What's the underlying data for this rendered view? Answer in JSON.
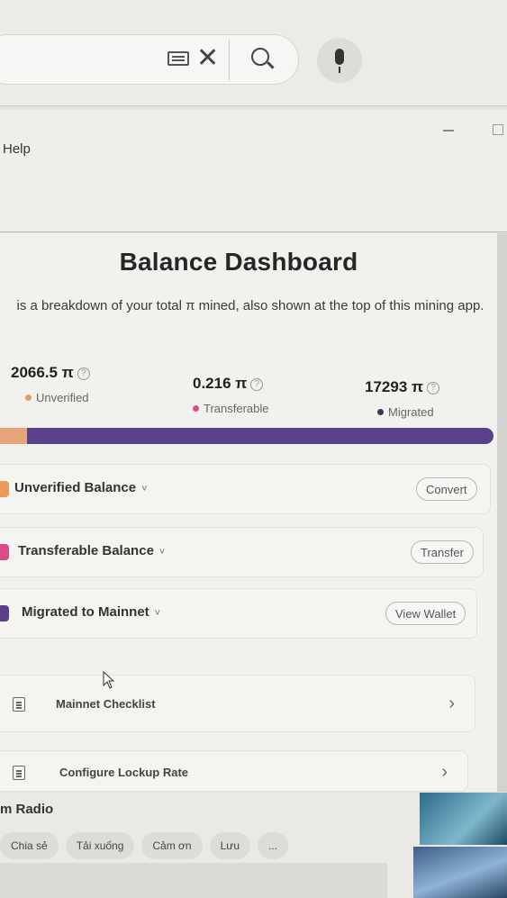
{
  "browser": {
    "icons": [
      "keyboard-icon",
      "close-icon",
      "search-icon",
      "microphone-icon"
    ]
  },
  "window": {
    "menu_help": "Help"
  },
  "dashboard": {
    "title": "Balance Dashboard",
    "description": "is a breakdown of your total π mined, also shown at the top of this mining app.",
    "stats": [
      {
        "value": "2066.5 π",
        "label": "Unverified",
        "color": "#e89a5c"
      },
      {
        "value": "0.216 π",
        "label": "Transferable",
        "color": "#d94b8a"
      },
      {
        "value": "17293 π",
        "label": "Migrated",
        "color": "#3b3556"
      }
    ],
    "bar_colors": {
      "unverified": "#e8a57a",
      "transferable": "#d94b8a",
      "migrated": "#5a3f8c"
    },
    "bar_fractions": {
      "unverified": 0.055,
      "transferable": 0.0,
      "migrated": 0.945
    },
    "rows": [
      {
        "label": "Unverified Balance",
        "button": "Convert",
        "color": "#e89a5c"
      },
      {
        "label": "Transferable Balance",
        "button": "Transfer",
        "color": "#d94b8a"
      },
      {
        "label": "Migrated to Mainnet",
        "button": "View Wallet",
        "color": "#5a3f8c"
      }
    ],
    "tasks": [
      {
        "label": "Mainnet Checklist"
      },
      {
        "label": "Configure Lockup Rate"
      }
    ],
    "help_symbol": "?",
    "chevron": "˅",
    "arrow": "›"
  },
  "video_page": {
    "channel": "m Radio",
    "actions": [
      "Chia sẻ",
      "Tải xuống",
      "Cảm ơn",
      "Lưu",
      "..."
    ]
  }
}
